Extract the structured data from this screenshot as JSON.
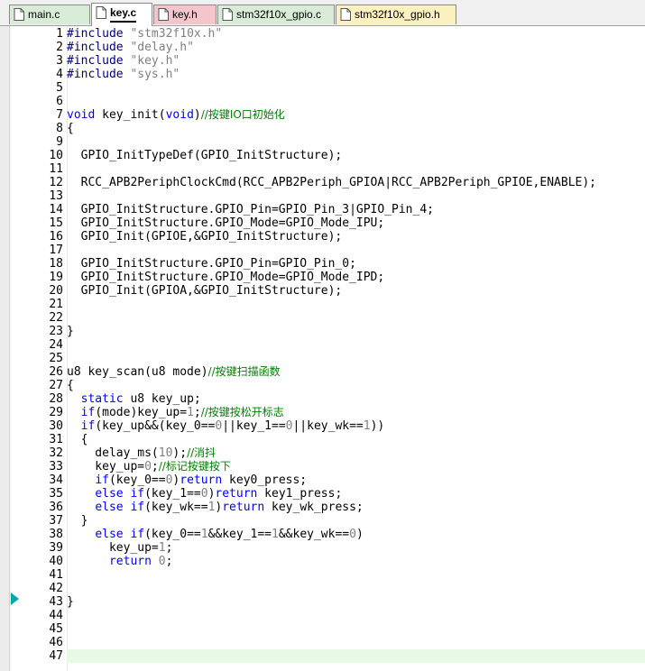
{
  "tabs": [
    {
      "label": "main.c",
      "bg": "#d8ecd8"
    },
    {
      "label": "key.c",
      "bg": "#ffffff",
      "active": true
    },
    {
      "label": "key.h",
      "bg": "#f4c6cc"
    },
    {
      "label": "stm32f10x_gpio.c",
      "bg": "#d8ecd8"
    },
    {
      "label": "stm32f10x_gpio.h",
      "bg": "#fbf0c0"
    }
  ],
  "colors": {
    "keyword": "#0000ff",
    "string": "#808080",
    "comment": "#008000",
    "current_line": "#e6fae6",
    "bookmark": "#00aaaa"
  },
  "icons": [
    "document-icon",
    "bookmark-arrow-icon"
  ],
  "lines": [
    {
      "n": "1",
      "tokens": [
        {
          "t": "pp",
          "v": "#include "
        },
        {
          "t": "str",
          "v": "\"stm32f10x.h\""
        }
      ]
    },
    {
      "n": "2",
      "tokens": [
        {
          "t": "pp",
          "v": "#include "
        },
        {
          "t": "str",
          "v": "\"delay.h\""
        }
      ]
    },
    {
      "n": "3",
      "tokens": [
        {
          "t": "pp",
          "v": "#include "
        },
        {
          "t": "str",
          "v": "\"key.h\""
        }
      ]
    },
    {
      "n": "4",
      "tokens": [
        {
          "t": "pp",
          "v": "#include "
        },
        {
          "t": "str",
          "v": "\"sys.h\""
        }
      ]
    },
    {
      "n": "5",
      "tokens": []
    },
    {
      "n": "6",
      "tokens": []
    },
    {
      "n": "7",
      "tokens": [
        {
          "t": "kw",
          "v": "void"
        },
        {
          "t": "",
          "v": " key_init("
        },
        {
          "t": "kw",
          "v": "void"
        },
        {
          "t": "",
          "v": ")"
        },
        {
          "t": "cm",
          "v": "//按键IO口初始化"
        }
      ]
    },
    {
      "n": "8",
      "tokens": [
        {
          "t": "",
          "v": "{"
        }
      ]
    },
    {
      "n": "9",
      "tokens": []
    },
    {
      "n": "10",
      "tokens": [
        {
          "t": "",
          "v": "  GPIO_InitTypeDef(GPIO_InitStructure);"
        }
      ]
    },
    {
      "n": "11",
      "tokens": []
    },
    {
      "n": "12",
      "tokens": [
        {
          "t": "",
          "v": "  RCC_APB2PeriphClockCmd(RCC_APB2Periph_GPIOA|RCC_APB2Periph_GPIOE,ENABLE);"
        }
      ]
    },
    {
      "n": "13",
      "tokens": []
    },
    {
      "n": "14",
      "tokens": [
        {
          "t": "",
          "v": "  GPIO_InitStructure.GPIO_Pin=GPIO_Pin_3|GPIO_Pin_4;"
        }
      ]
    },
    {
      "n": "15",
      "tokens": [
        {
          "t": "",
          "v": "  GPIO_InitStructure.GPIO_Mode=GPIO_Mode_IPU;"
        }
      ]
    },
    {
      "n": "16",
      "tokens": [
        {
          "t": "",
          "v": "  GPIO_Init(GPIOE,&GPIO_InitStructure);"
        }
      ]
    },
    {
      "n": "17",
      "tokens": []
    },
    {
      "n": "18",
      "tokens": [
        {
          "t": "",
          "v": "  GPIO_InitStructure.GPIO_Pin=GPIO_Pin_0;"
        }
      ]
    },
    {
      "n": "19",
      "tokens": [
        {
          "t": "",
          "v": "  GPIO_InitStructure.GPIO_Mode=GPIO_Mode_IPD;"
        }
      ]
    },
    {
      "n": "20",
      "tokens": [
        {
          "t": "",
          "v": "  GPIO_Init(GPIOA,&GPIO_InitStructure);"
        }
      ]
    },
    {
      "n": "21",
      "tokens": []
    },
    {
      "n": "22",
      "tokens": []
    },
    {
      "n": "23",
      "tokens": [
        {
          "t": "",
          "v": "}"
        }
      ]
    },
    {
      "n": "24",
      "tokens": []
    },
    {
      "n": "25",
      "tokens": []
    },
    {
      "n": "26",
      "tokens": [
        {
          "t": "",
          "v": "u8 key_scan(u8 mode)"
        },
        {
          "t": "cm",
          "v": "//按键扫描函数"
        }
      ]
    },
    {
      "n": "27",
      "tokens": [
        {
          "t": "",
          "v": "{"
        }
      ]
    },
    {
      "n": "28",
      "tokens": [
        {
          "t": "",
          "v": "  "
        },
        {
          "t": "kw",
          "v": "static"
        },
        {
          "t": "",
          "v": " u8 key_up;"
        }
      ]
    },
    {
      "n": "29",
      "tokens": [
        {
          "t": "",
          "v": "  "
        },
        {
          "t": "kw",
          "v": "if"
        },
        {
          "t": "",
          "v": "(mode)key_up="
        },
        {
          "t": "num",
          "v": "1"
        },
        {
          "t": "",
          "v": ";"
        },
        {
          "t": "cm",
          "v": "//按键按松开标志"
        }
      ]
    },
    {
      "n": "30",
      "tokens": [
        {
          "t": "",
          "v": "  "
        },
        {
          "t": "kw",
          "v": "if"
        },
        {
          "t": "",
          "v": "(key_up&&(key_0=="
        },
        {
          "t": "num",
          "v": "0"
        },
        {
          "t": "",
          "v": "||key_1=="
        },
        {
          "t": "num",
          "v": "0"
        },
        {
          "t": "",
          "v": "||key_wk=="
        },
        {
          "t": "num",
          "v": "1"
        },
        {
          "t": "",
          "v": "))"
        }
      ]
    },
    {
      "n": "31",
      "tokens": [
        {
          "t": "",
          "v": "  {"
        }
      ]
    },
    {
      "n": "32",
      "tokens": [
        {
          "t": "",
          "v": "    delay_ms("
        },
        {
          "t": "num",
          "v": "10"
        },
        {
          "t": "",
          "v": ");"
        },
        {
          "t": "cm",
          "v": "//消抖"
        }
      ]
    },
    {
      "n": "33",
      "tokens": [
        {
          "t": "",
          "v": "    key_up="
        },
        {
          "t": "num",
          "v": "0"
        },
        {
          "t": "",
          "v": ";"
        },
        {
          "t": "cm",
          "v": "//标记按键按下"
        }
      ]
    },
    {
      "n": "34",
      "tokens": [
        {
          "t": "",
          "v": "    "
        },
        {
          "t": "kw",
          "v": "if"
        },
        {
          "t": "",
          "v": "(key_0=="
        },
        {
          "t": "num",
          "v": "0"
        },
        {
          "t": "",
          "v": ")"
        },
        {
          "t": "kw",
          "v": "return"
        },
        {
          "t": "",
          "v": " key0_press;"
        }
      ]
    },
    {
      "n": "35",
      "tokens": [
        {
          "t": "",
          "v": "    "
        },
        {
          "t": "kw",
          "v": "else if"
        },
        {
          "t": "",
          "v": "(key_1=="
        },
        {
          "t": "num",
          "v": "0"
        },
        {
          "t": "",
          "v": ")"
        },
        {
          "t": "kw",
          "v": "return"
        },
        {
          "t": "",
          "v": " key1_press;"
        }
      ]
    },
    {
      "n": "36",
      "tokens": [
        {
          "t": "",
          "v": "    "
        },
        {
          "t": "kw",
          "v": "else if"
        },
        {
          "t": "",
          "v": "(key_wk=="
        },
        {
          "t": "num",
          "v": "1"
        },
        {
          "t": "",
          "v": ")"
        },
        {
          "t": "kw",
          "v": "return"
        },
        {
          "t": "",
          "v": " key_wk_press;"
        }
      ]
    },
    {
      "n": "37",
      "tokens": [
        {
          "t": "",
          "v": "  }"
        }
      ]
    },
    {
      "n": "38",
      "tokens": [
        {
          "t": "",
          "v": "    "
        },
        {
          "t": "kw",
          "v": "else if"
        },
        {
          "t": "",
          "v": "(key_0=="
        },
        {
          "t": "num",
          "v": "1"
        },
        {
          "t": "",
          "v": "&&key_1=="
        },
        {
          "t": "num",
          "v": "1"
        },
        {
          "t": "",
          "v": "&&key_wk=="
        },
        {
          "t": "num",
          "v": "0"
        },
        {
          "t": "",
          "v": ")"
        }
      ]
    },
    {
      "n": "39",
      "tokens": [
        {
          "t": "",
          "v": "      key_up="
        },
        {
          "t": "num",
          "v": "1"
        },
        {
          "t": "",
          "v": ";"
        }
      ]
    },
    {
      "n": "40",
      "tokens": [
        {
          "t": "",
          "v": "      "
        },
        {
          "t": "kw",
          "v": "return"
        },
        {
          "t": "",
          "v": " "
        },
        {
          "t": "num",
          "v": "0"
        },
        {
          "t": "",
          "v": ";"
        }
      ]
    },
    {
      "n": "41",
      "tokens": []
    },
    {
      "n": "42",
      "tokens": []
    },
    {
      "n": "43",
      "tokens": [
        {
          "t": "",
          "v": "}"
        }
      ]
    },
    {
      "n": "44",
      "tokens": []
    },
    {
      "n": "45",
      "tokens": []
    },
    {
      "n": "46",
      "tokens": []
    },
    {
      "n": "47",
      "tokens": []
    }
  ]
}
